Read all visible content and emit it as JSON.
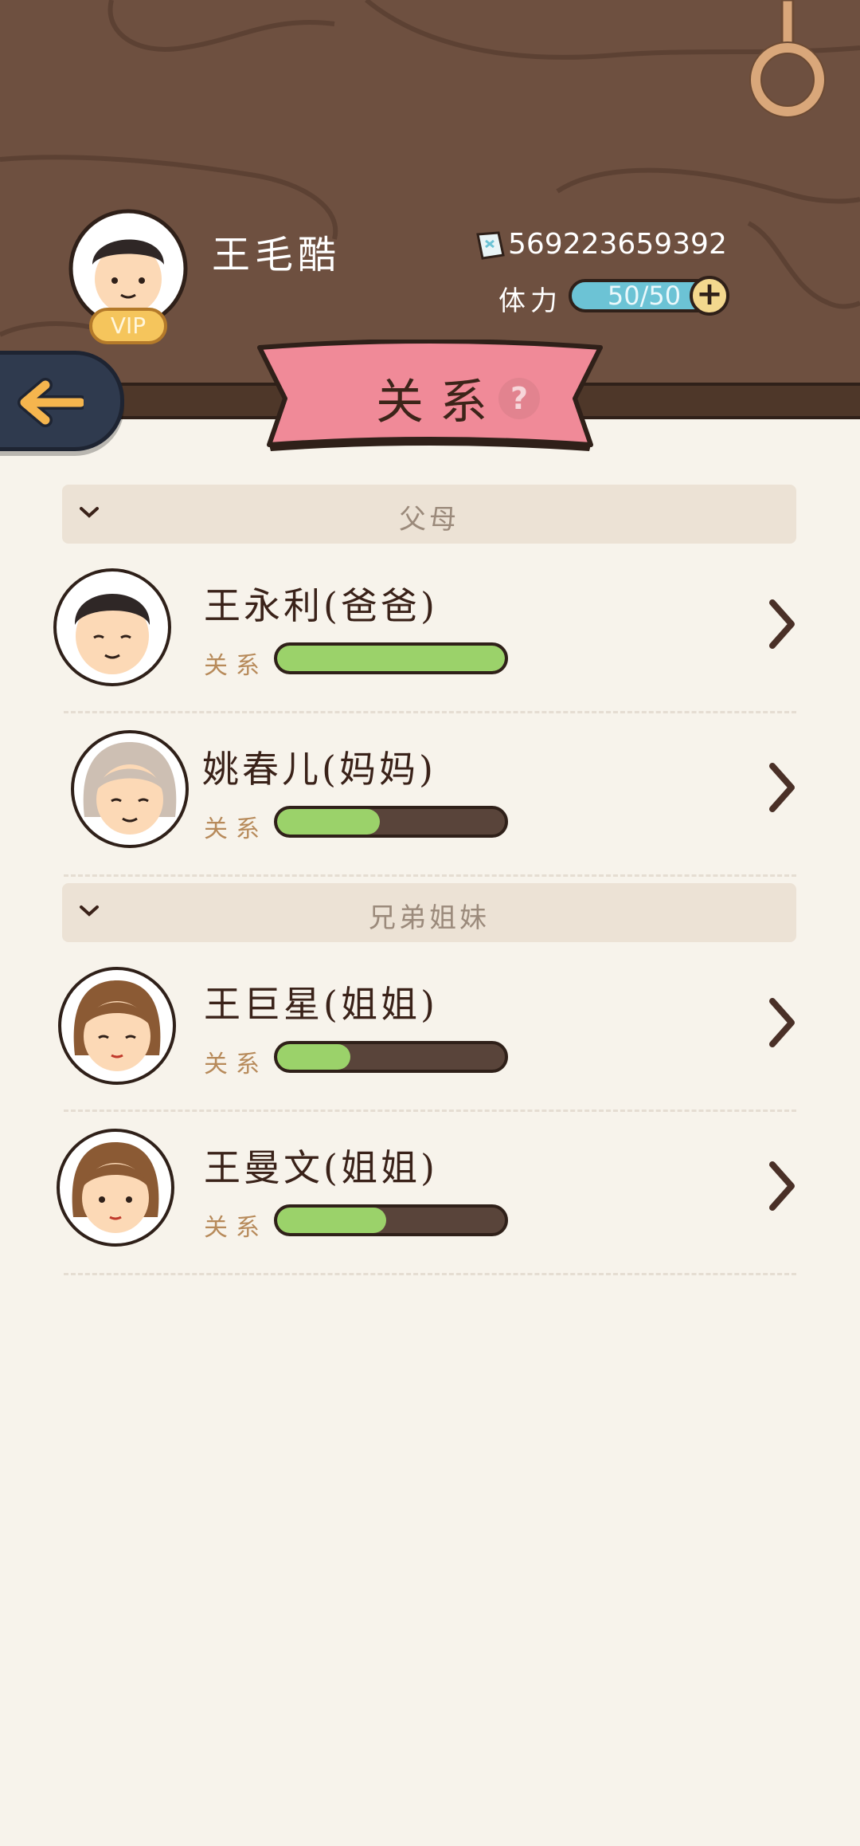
{
  "player": {
    "name": "王毛酷",
    "vip_label": "VIP",
    "currency": "569223659392",
    "stamina_label": "体力",
    "stamina_value": "50/50",
    "stamina_add": "+"
  },
  "page": {
    "title": "关系",
    "help": "?"
  },
  "sections": [
    {
      "label": "父母"
    },
    {
      "label": "兄弟姐妹"
    }
  ],
  "relationship_label": "关系",
  "members": [
    {
      "name": "王永利(爸爸)",
      "relationship": 1.0
    },
    {
      "name": "姚春儿(妈妈)",
      "relationship": 0.45
    },
    {
      "name": "王巨星(姐姐)",
      "relationship": 0.32
    },
    {
      "name": "王曼文(姐姐)",
      "relationship": 0.48
    }
  ],
  "colors": {
    "header_wood": "#6e5040",
    "banner_pink": "#f08a98",
    "bar_green": "#9bd26a",
    "stamina_blue": "#6cc3d5",
    "background": "#f7f3eb"
  }
}
